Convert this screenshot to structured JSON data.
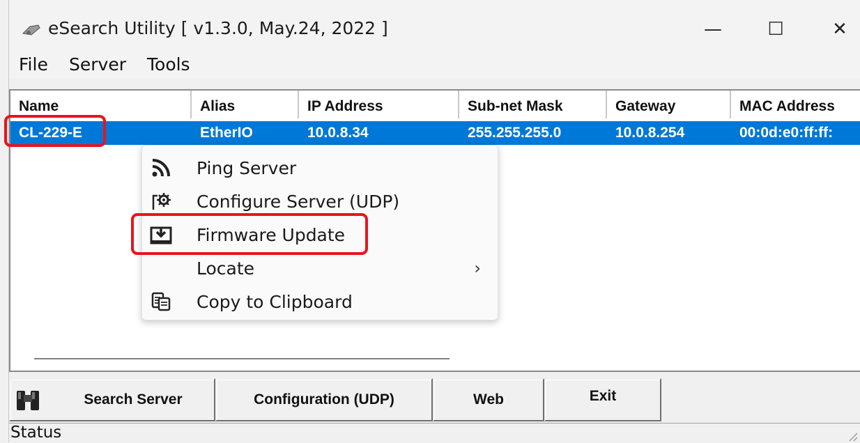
{
  "window": {
    "title": "eSearch Utility [ v1.3.0, May.24, 2022 ]",
    "controls": {
      "minimize": "—",
      "maximize": "☐",
      "close": "✕"
    }
  },
  "menu": [
    "File",
    "Server",
    "Tools"
  ],
  "table": {
    "columns": [
      "Name",
      "Alias",
      "IP Address",
      "Sub-net Mask",
      "Gateway",
      "MAC Address"
    ],
    "rows": [
      {
        "name": "CL-229-E",
        "alias": "EtherIO",
        "ip": "10.0.8.34",
        "mask": "255.255.255.0",
        "gateway": "10.0.8.254",
        "mac": "00:0d:e0:ff:ff:"
      }
    ],
    "selected_row_color": "#0078d7"
  },
  "context_menu": {
    "items": [
      {
        "label": "Ping Server",
        "icon": "ping-icon"
      },
      {
        "label": "Configure Server (UDP)",
        "icon": "gear-icon"
      },
      {
        "label": "Firmware Update",
        "icon": "download-icon"
      },
      {
        "label": "Locate",
        "icon": "",
        "submenu_arrow": "›"
      },
      {
        "label": "Copy to Clipboard",
        "icon": "clipboard-icon"
      }
    ]
  },
  "buttons": {
    "search": "Search Server",
    "config": "Configuration (UDP)",
    "web": "Web",
    "exit": "Exit"
  },
  "status": {
    "label": "Status"
  },
  "highlight_color": "#e8141c"
}
